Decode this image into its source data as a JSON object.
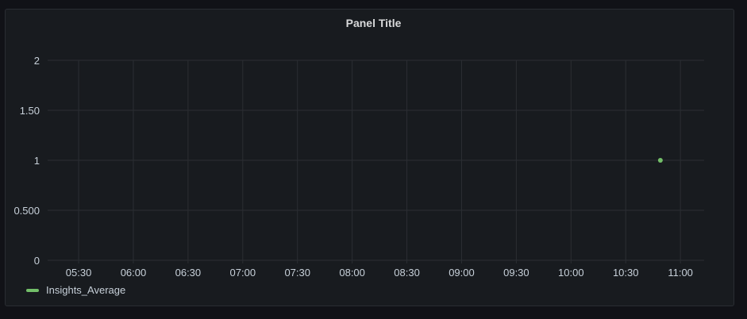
{
  "panel": {
    "title": "Panel Title"
  },
  "chart_data": {
    "type": "scatter",
    "title": "Panel Title",
    "xlabel": "",
    "ylabel": "",
    "x_ticks": [
      "05:30",
      "06:00",
      "06:30",
      "07:00",
      "07:30",
      "08:00",
      "08:30",
      "09:00",
      "09:30",
      "10:00",
      "10:30",
      "11:00"
    ],
    "x_tick_minutes": [
      330,
      360,
      390,
      420,
      450,
      480,
      510,
      540,
      570,
      600,
      630,
      660
    ],
    "xlim_minutes": [
      313,
      673
    ],
    "y_ticks": [
      "0",
      "0.500",
      "1",
      "1.50",
      "2"
    ],
    "y_tick_values": [
      0,
      0.5,
      1,
      1.5,
      2
    ],
    "ylim": [
      0,
      2
    ],
    "grid": true,
    "legend_position": "bottom-left",
    "series": [
      {
        "name": "Insights_Average",
        "color": "#73bf69",
        "points": [
          {
            "x": "10:49",
            "x_minutes": 649,
            "y": 1
          }
        ]
      }
    ]
  }
}
